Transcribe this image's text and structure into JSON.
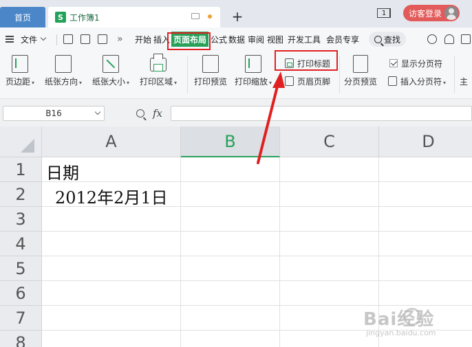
{
  "window": {
    "home_tab": "首页",
    "doc_tab": "工作簿1",
    "doc_logo": "S",
    "new_tab": "+",
    "window_count": "1",
    "login_label": "访客登录"
  },
  "menu": {
    "file_label": "文件",
    "more_label": "»",
    "tabs": [
      "开始",
      "插入",
      "页面布局",
      "公式",
      "数据",
      "审阅",
      "视图",
      "开发工具",
      "会员专享"
    ],
    "search_label": "查找"
  },
  "ribbon": {
    "margins": "页边距",
    "orientation": "纸张方向",
    "size": "纸张大小",
    "print_area": "打印区域",
    "print_preview": "打印预览",
    "print_scale": "打印缩放",
    "print_titles": "打印标题",
    "header_footer": "页眉页脚",
    "page_break_preview": "分页预览",
    "show_page_breaks": "显示分页符",
    "insert_page_break": "插入分页符",
    "theme": "主"
  },
  "formula_bar": {
    "cell_ref": "B16",
    "fx_label": "fx",
    "value": ""
  },
  "grid": {
    "columns": [
      "A",
      "B",
      "C",
      "D"
    ],
    "selected_column": "B",
    "rows": [
      "1",
      "2",
      "3",
      "4",
      "5",
      "6",
      "7",
      "8"
    ],
    "cells": {
      "A1": "日期",
      "A2": "2012年2月1日"
    }
  },
  "watermark": {
    "brand": "Bai经验",
    "url": "jingyan.baidu.com"
  },
  "colors": {
    "accent_green": "#27a05a",
    "highlight_red": "#e02020",
    "home_tab_blue": "#4a86c8",
    "login_red": "#e25a5a"
  }
}
